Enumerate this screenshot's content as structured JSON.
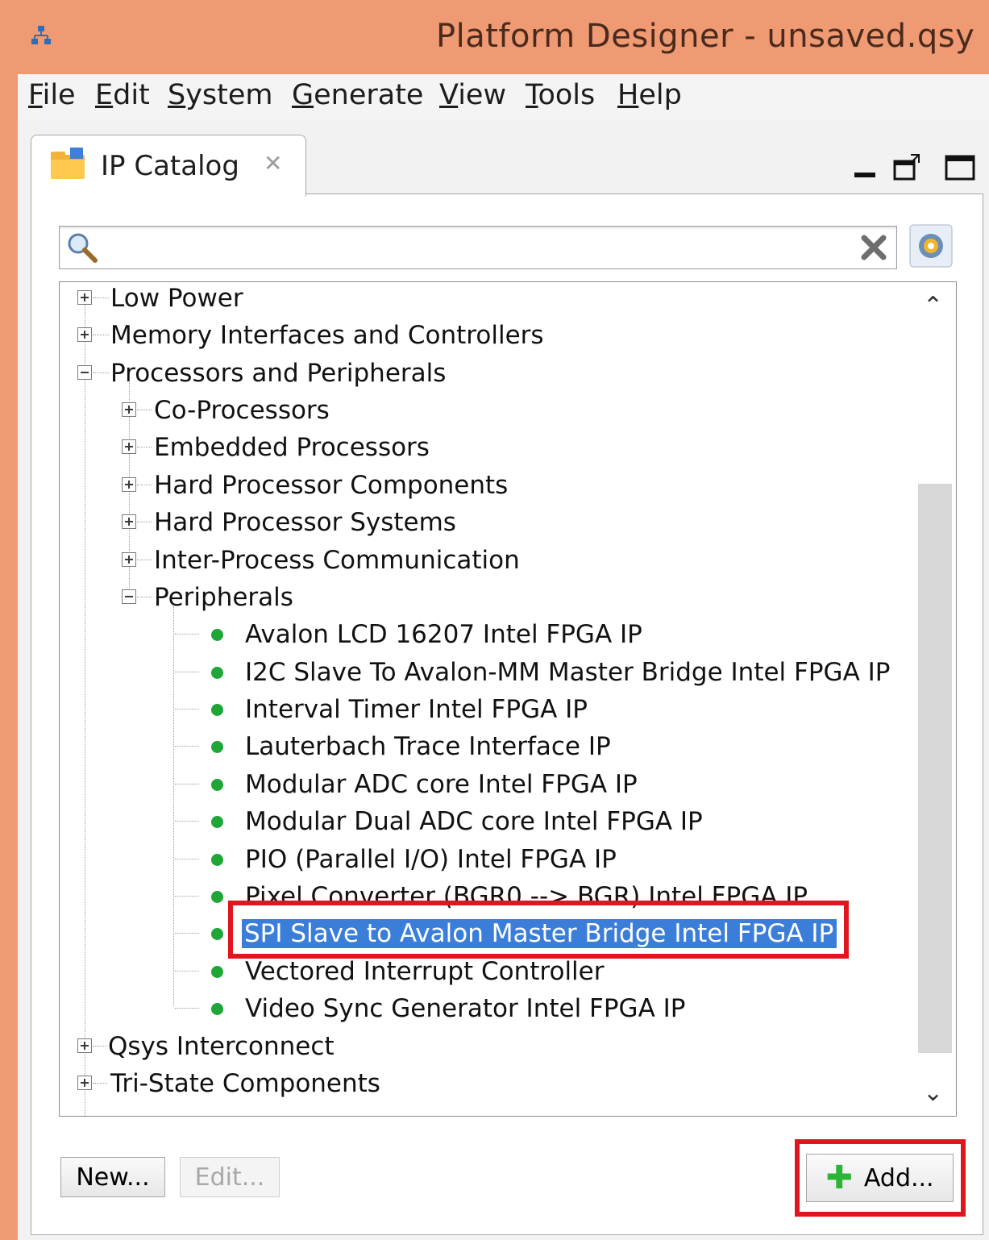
{
  "window": {
    "title": "Platform Designer - unsaved.qsy"
  },
  "menu": [
    "File",
    "Edit",
    "System",
    "Generate",
    "View",
    "Tools",
    "Help"
  ],
  "tab": {
    "label": "IP Catalog"
  },
  "search": {
    "value": "",
    "placeholder": ""
  },
  "tree": {
    "top": [
      {
        "label": "Low Power",
        "expanded": false
      },
      {
        "label": "Memory Interfaces and Controllers",
        "expanded": false
      },
      {
        "label": "Processors and Peripherals",
        "expanded": true
      }
    ],
    "processors_children": [
      {
        "label": "Co-Processors",
        "expanded": false
      },
      {
        "label": "Embedded Processors",
        "expanded": false
      },
      {
        "label": "Hard Processor Components",
        "expanded": false
      },
      {
        "label": "Hard Processor Systems",
        "expanded": false
      },
      {
        "label": "Inter-Process Communication",
        "expanded": false
      },
      {
        "label": "Peripherals",
        "expanded": true
      }
    ],
    "peripherals": [
      "Avalon LCD 16207 Intel FPGA IP",
      "I2C Slave To Avalon-MM Master Bridge Intel FPGA IP",
      "Interval Timer Intel FPGA IP",
      "Lauterbach Trace Interface IP",
      "Modular ADC core Intel FPGA IP",
      "Modular Dual ADC core Intel FPGA IP",
      "PIO (Parallel I/O) Intel FPGA IP",
      "Pixel Converter (BGR0 --> BGR) Intel FPGA IP",
      "SPI Slave to Avalon Master Bridge Intel FPGA IP",
      "Vectored Interrupt Controller",
      "Video Sync Generator Intel FPGA IP"
    ],
    "bottom": [
      {
        "label": "Qsys Interconnect",
        "expanded": false
      },
      {
        "label": "Tri-State Components",
        "expanded": false
      }
    ],
    "selected": "SPI Slave to Avalon Master Bridge Intel FPGA IP"
  },
  "buttons": {
    "new": "New...",
    "edit": "Edit...",
    "add": "Add..."
  },
  "colors": {
    "titlebar": "#ef9a73",
    "selection": "#3a7ed9",
    "highlight": "#e0161e",
    "status_dot": "#1fa637"
  }
}
